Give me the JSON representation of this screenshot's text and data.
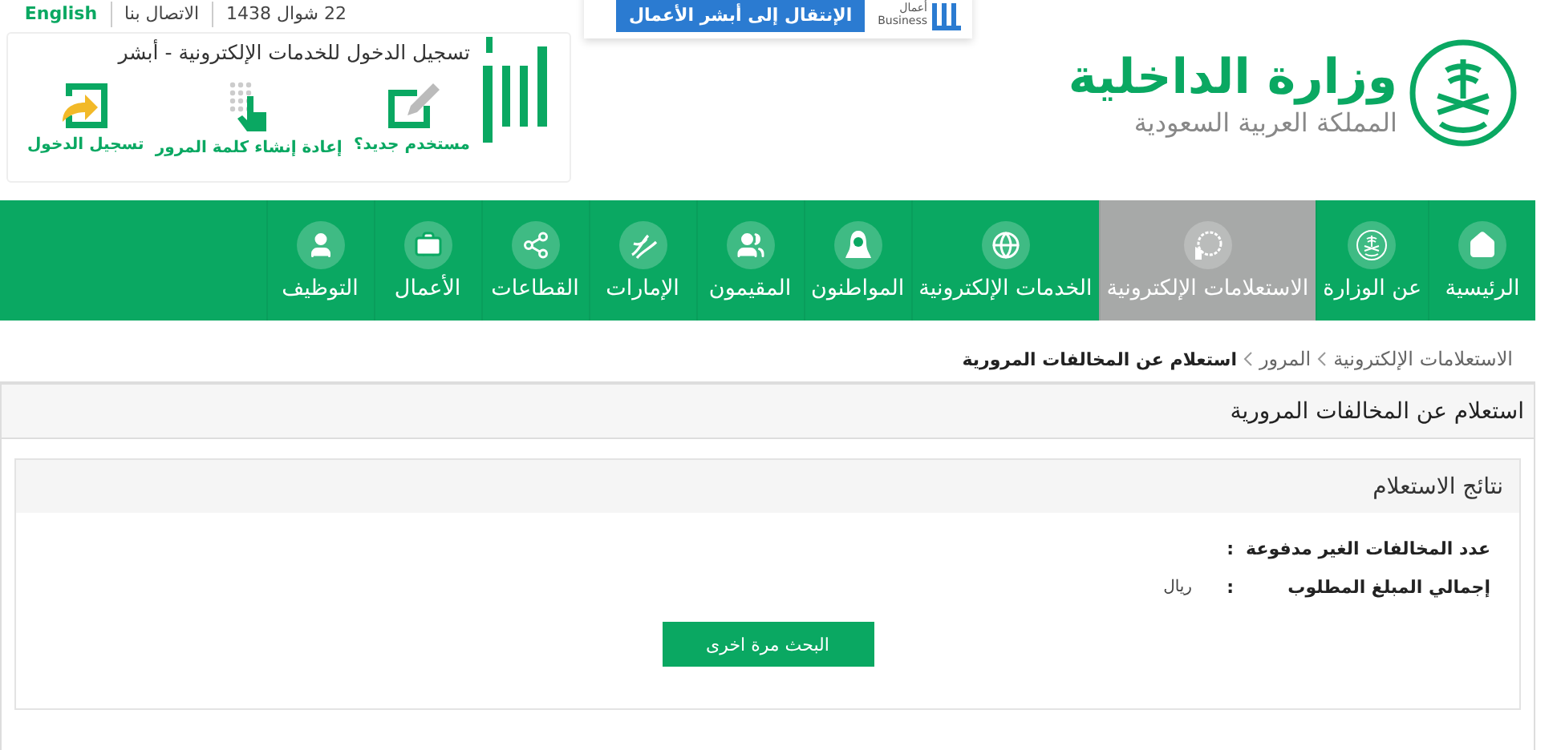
{
  "top_links": [
    {
      "label": "22 شوال 1438",
      "kind": "date"
    },
    {
      "label": "الاتصال بنا",
      "kind": "link"
    },
    {
      "label": "English",
      "kind": "language"
    }
  ],
  "login_box": {
    "title": "تسجيل الدخول للخدمات الإلكترونية - أبشر",
    "actions": [
      {
        "label": "مستخدم جديد؟",
        "kind": "register"
      },
      {
        "label": "إعادة إنشاء كلمة المرور",
        "kind": "reset"
      },
      {
        "label": "تسجيل الدخول",
        "kind": "login"
      }
    ]
  },
  "business": {
    "logo_text": "أعمال",
    "logo_subtext": "Business",
    "button": "الإنتقال إلى أبشر الأعمال"
  },
  "brand": {
    "title": "وزارة الداخلية",
    "subtitle": "المملكة العربية السعودية"
  },
  "nav": [
    {
      "label": "الرئيسية",
      "selected": false
    },
    {
      "label": "عن الوزارة",
      "selected": false
    },
    {
      "label": "الاستعلامات الإلكترونية",
      "selected": true
    },
    {
      "label": "الخدمات الإلكترونية",
      "selected": false
    },
    {
      "label": "المواطنون",
      "selected": false
    },
    {
      "label": "المقيمون",
      "selected": false
    },
    {
      "label": "الإمارات",
      "selected": false
    },
    {
      "label": "القطاعات",
      "selected": false
    },
    {
      "label": "الأعمال",
      "selected": false
    },
    {
      "label": "التوظيف",
      "selected": false
    }
  ],
  "breadcrumb": [
    {
      "label": "الاستعلامات الإلكترونية",
      "current": false
    },
    {
      "label": "المرور",
      "current": false
    },
    {
      "label": "استعلام عن المخالفات المرورية",
      "current": true
    }
  ],
  "panel": {
    "title": "استعلام عن المخالفات المرورية",
    "results": {
      "title": "نتائج الاستعلام",
      "rows": [
        {
          "label": "عدد المخالفات الغير مدفوعة",
          "separator": ":"
        },
        {
          "label": "إجمالي المبلغ المطلوب",
          "separator": ":",
          "unit": "ريال"
        }
      ],
      "button": "البحث مرة اخرى"
    }
  }
}
